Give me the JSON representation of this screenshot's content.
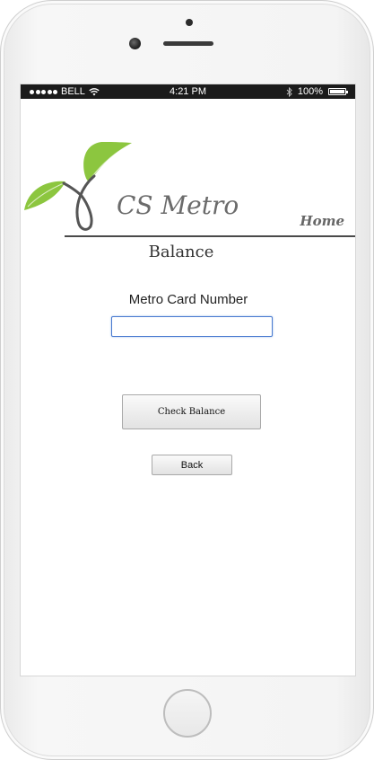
{
  "status_bar": {
    "carrier": "BELL",
    "time": "4:21 PM",
    "battery": "100%",
    "battery_level": 1.0,
    "signal_bars": 5,
    "icons": [
      "wifi-icon",
      "bluetooth-icon",
      "battery-icon"
    ]
  },
  "header": {
    "brand": "CS Metro",
    "home_link": "Home",
    "logo_icon": "leaf-logo-icon",
    "colors": {
      "leaf": "#8cc63f",
      "stem": "#555555",
      "brand_text": "#6b6b6b"
    }
  },
  "main": {
    "title": "Balance",
    "card_label": "Metro Card Number",
    "card_value": "",
    "card_placeholder": "",
    "check_button": "Check Balance",
    "back_button": "Back"
  },
  "colors": {
    "input_border": "#4a7bd0",
    "status_bar_bg": "#1b1b1b"
  }
}
